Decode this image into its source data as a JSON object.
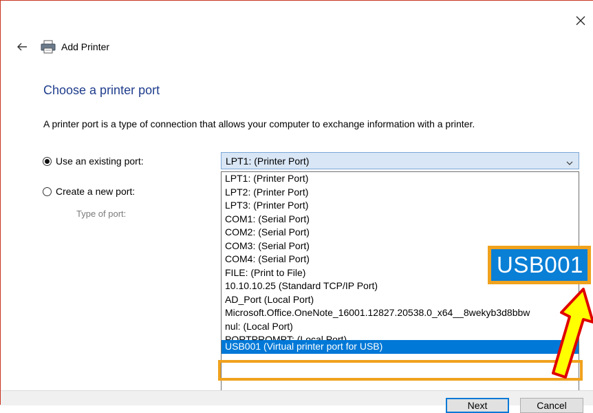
{
  "window": {
    "title": "Add Printer"
  },
  "page": {
    "heading": "Choose a printer port",
    "description": "A printer port is a type of connection that allows your computer to exchange information with a printer."
  },
  "options": {
    "existing_label": "Use an existing port:",
    "new_label": "Create a new port:",
    "type_label": "Type of port:",
    "existing_checked": true
  },
  "port_select": {
    "value": "LPT1: (Printer Port)",
    "items": [
      "LPT1: (Printer Port)",
      "LPT2: (Printer Port)",
      "LPT3: (Printer Port)",
      "COM1: (Serial Port)",
      "COM2: (Serial Port)",
      "COM3: (Serial Port)",
      "COM4: (Serial Port)",
      "FILE: (Print to File)",
      "10.10.10.25 (Standard TCP/IP Port)",
      "AD_Port (Local Port)",
      "Microsoft.Office.OneNote_16001.12827.20538.0_x64__8wekyb3d8bbw",
      "nul: (Local Port)",
      "PORTPROMPT: (Local Port)"
    ],
    "selected_item": "USB001 (Virtual printer port for USB)"
  },
  "callout": {
    "text": "USB001"
  },
  "buttons": {
    "next": "Next",
    "cancel": "Cancel"
  },
  "colors": {
    "heading": "#1f3d8c",
    "selection": "#0078d7",
    "highlight_box": "#f0a21d",
    "arrow_fill": "#ffff00",
    "arrow_stroke": "#e00000"
  },
  "icons": {
    "close": "close-icon",
    "back": "back-arrow-icon",
    "printer": "printer-icon",
    "dropdown": "chevron-down-icon"
  }
}
